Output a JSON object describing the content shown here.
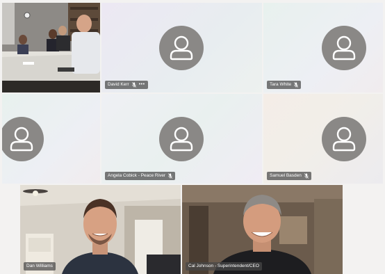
{
  "participants": [
    {
      "name": "David Kerr",
      "muted": true,
      "has_more": true
    },
    {
      "name": "Tara White",
      "muted": true
    },
    {
      "name": "Angela Cobick - Peace River",
      "muted": true
    },
    {
      "name": "Samuel Basden",
      "muted": true
    },
    {
      "name": "Dan Williams",
      "video": true
    },
    {
      "name": "Cal Johnson - Superintendent/CEO",
      "video": true
    }
  ],
  "icons": {
    "avatar": "person-avatar-icon",
    "mic": "mic-muted-icon",
    "more": "more-options-icon"
  },
  "more_label": "•••",
  "colors": {
    "avatar_bg": "#8a8886",
    "nametag_bg": "#464646",
    "grid_bg": "#f3f2f1"
  }
}
